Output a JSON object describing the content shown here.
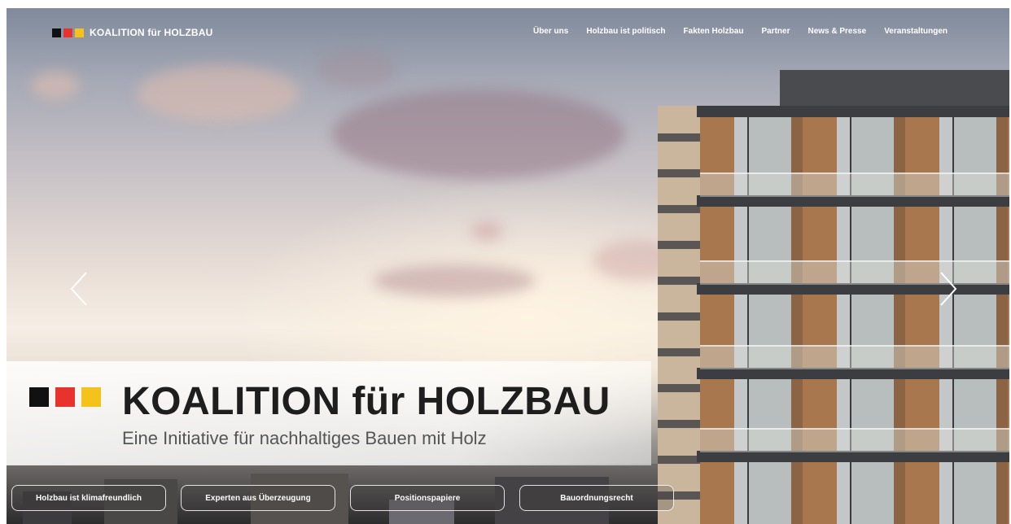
{
  "colors": {
    "black": "#111111",
    "red": "#e8322e",
    "gold": "#f5c21b"
  },
  "header": {
    "logo_text": "KOALITION für HOLZBAU",
    "nav": [
      "Über uns",
      "Holzbau ist politisch",
      "Fakten Holzbau",
      "Partner",
      "News & Presse",
      "Veranstaltungen"
    ]
  },
  "hero": {
    "title": "KOALITION für HOLZBAU",
    "subtitle": "Eine Initiative für nachhaltiges Bauen mit Holz",
    "prev_icon": "chevron-left-icon",
    "next_icon": "chevron-right-icon"
  },
  "quick_links": [
    "Holzbau ist klimafreundlich",
    "Experten aus Überzeugung",
    "Positionspapiere",
    "Bauordnungsrecht"
  ]
}
